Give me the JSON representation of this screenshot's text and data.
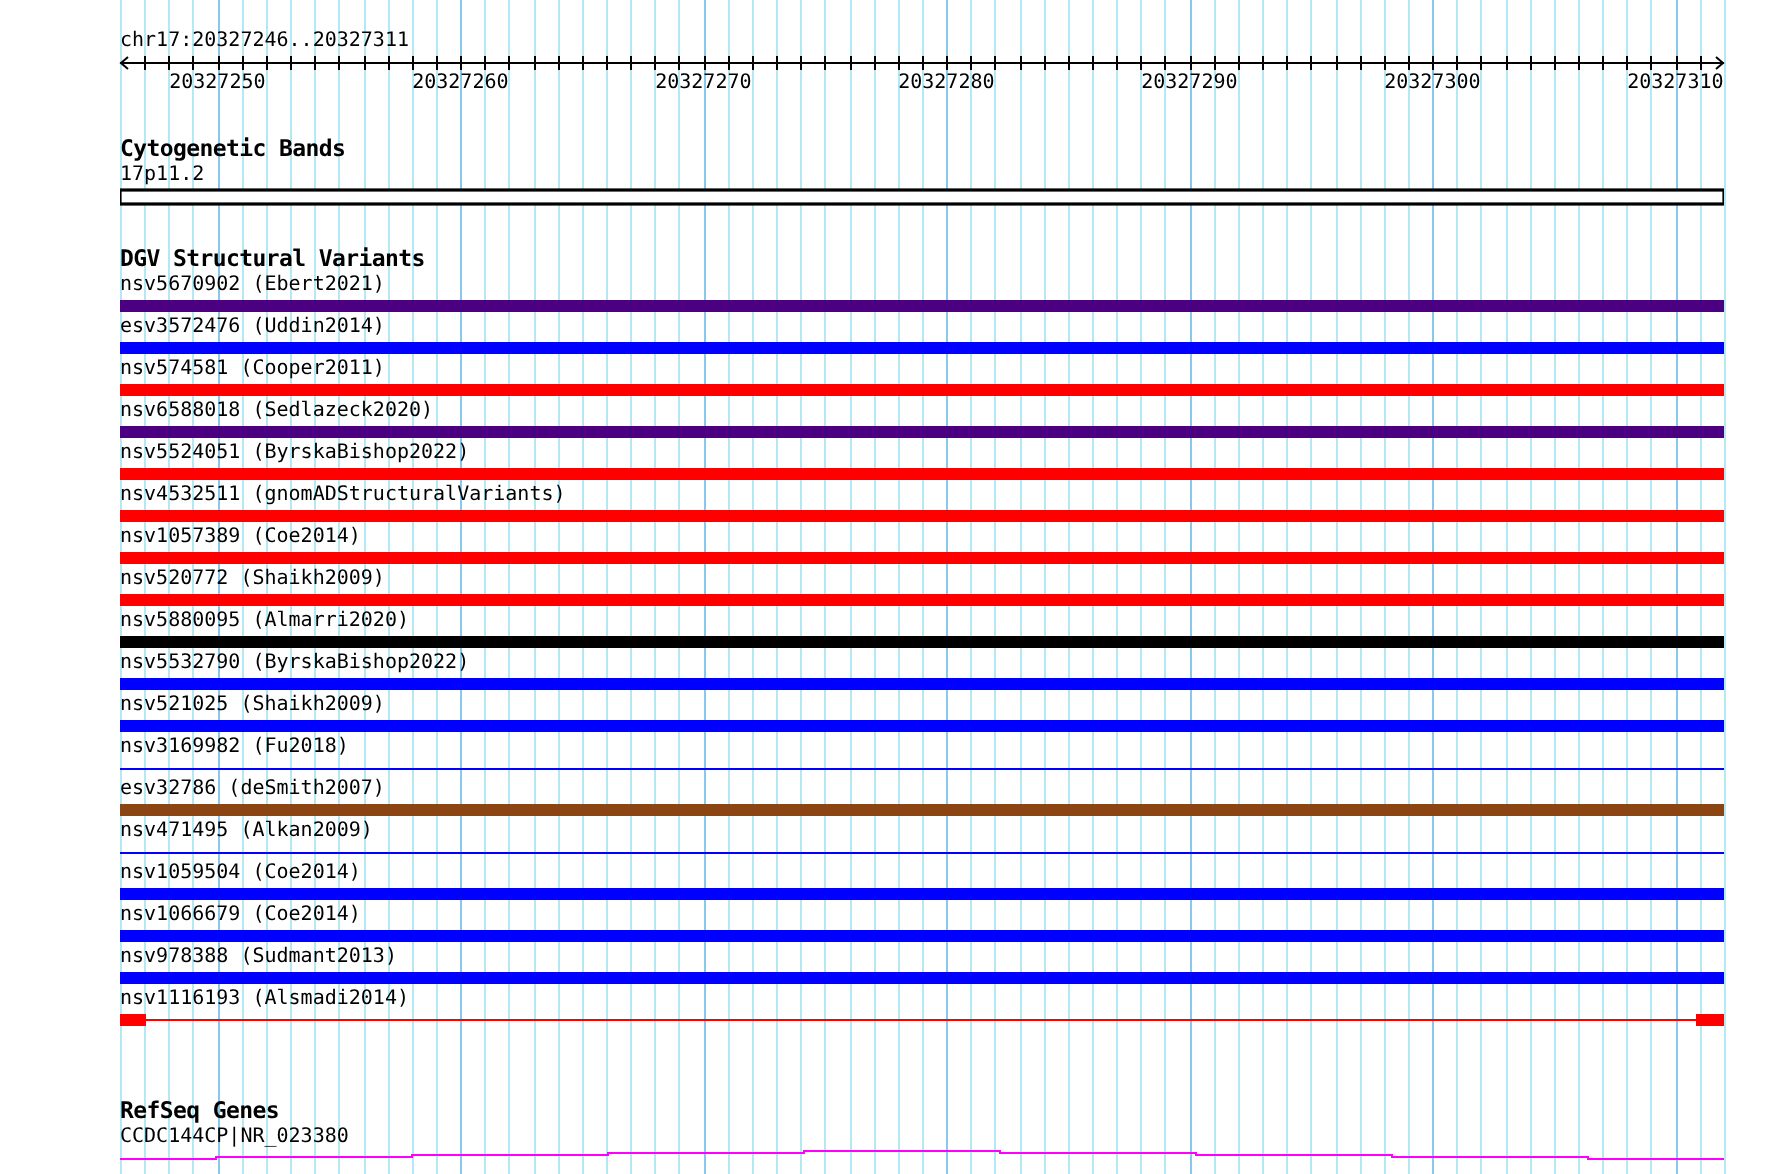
{
  "ruler": {
    "location": "chr17:20327246..20327311",
    "ticks": [
      "20327250",
      "20327260",
      "20327270",
      "20327280",
      "20327290",
      "20327300",
      "20327310"
    ]
  },
  "tracks": [
    {
      "kind": "cytoband",
      "title": "Cytogenetic Bands",
      "label": "17p11.2"
    },
    {
      "kind": "variants",
      "title": "DGV Structural Variants",
      "features": [
        {
          "label": "nsv5670902 (Ebert2021)",
          "kind": "thick",
          "color": "#4b0082"
        },
        {
          "label": "esv3572476 (Uddin2014)",
          "kind": "thick",
          "color": "#0000ff"
        },
        {
          "label": "nsv574581 (Cooper2011)",
          "kind": "thick",
          "color": "#ff0000"
        },
        {
          "label": "nsv6588018 (Sedlazeck2020)",
          "kind": "thick",
          "color": "#4b0082"
        },
        {
          "label": "nsv5524051 (ByrskaBishop2022)",
          "kind": "thick",
          "color": "#ff0000"
        },
        {
          "label": "nsv4532511 (gnomADStructuralVariants)",
          "kind": "thick",
          "color": "#ff0000"
        },
        {
          "label": "nsv1057389 (Coe2014)",
          "kind": "thick",
          "color": "#ff0000"
        },
        {
          "label": "nsv520772 (Shaikh2009)",
          "kind": "thick",
          "color": "#ff0000"
        },
        {
          "label": "nsv5880095 (Almarri2020)",
          "kind": "thick",
          "color": "#000000"
        },
        {
          "label": "nsv5532790 (ByrskaBishop2022)",
          "kind": "thick",
          "color": "#0000ff"
        },
        {
          "label": "nsv521025 (Shaikh2009)",
          "kind": "thick",
          "color": "#0000ff"
        },
        {
          "label": "nsv3169982 (Fu2018)",
          "kind": "thin",
          "color": "#0000ff"
        },
        {
          "label": "esv32786 (deSmith2007)",
          "kind": "thick",
          "color": "#8b4513"
        },
        {
          "label": "nsv471495 (Alkan2009)",
          "kind": "thin",
          "color": "#0000ff"
        },
        {
          "label": "nsv1059504 (Coe2014)",
          "kind": "thick",
          "color": "#0000ff"
        },
        {
          "label": "nsv1066679 (Coe2014)",
          "kind": "thick",
          "color": "#0000ff"
        },
        {
          "label": "nsv978388 (Sudmant2013)",
          "kind": "thick",
          "color": "#0000ff"
        },
        {
          "label": "nsv1116193 (Alsmadi2014)",
          "kind": "ends",
          "color": "#ff0000"
        }
      ]
    },
    {
      "kind": "genes",
      "title": "RefSeq Genes",
      "label": "CCDC144CP|NR_023380"
    }
  ]
}
